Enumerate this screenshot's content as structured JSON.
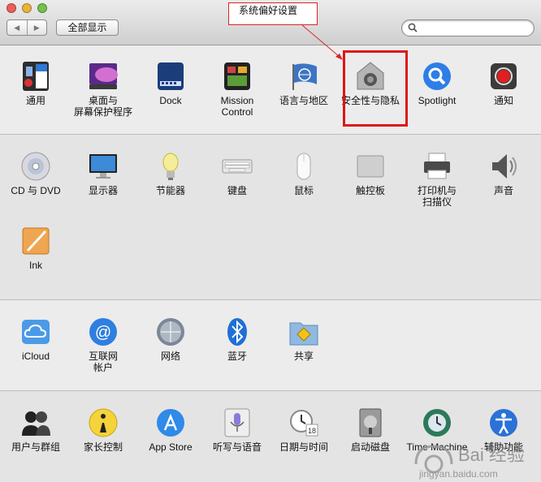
{
  "window": {
    "traffic_lights": [
      "#ec5f56",
      "#e9b43b",
      "#74c14c"
    ]
  },
  "toolbar": {
    "show_all_label": "全部显示",
    "back_icon": "chevron-left-icon",
    "forward_icon": "chevron-right-icon",
    "search_placeholder": ""
  },
  "annotation": {
    "text": "系统偏好设置",
    "highlight_color": "#e01515"
  },
  "rows": [
    [
      {
        "label": "通用",
        "icon": "general-icon"
      },
      {
        "label": "桌面与\n屏幕保护程序",
        "icon": "desktop-icon"
      },
      {
        "label": "Dock",
        "icon": "dock-icon"
      },
      {
        "label": "Mission\nControl",
        "icon": "mission-control-icon"
      },
      {
        "label": "语言与地区",
        "icon": "language-region-icon"
      },
      {
        "label": "安全性与隐私",
        "icon": "security-icon"
      },
      {
        "label": "Spotlight",
        "icon": "spotlight-icon"
      },
      {
        "label": "通知",
        "icon": "notifications-icon"
      }
    ],
    [
      {
        "label": "CD 与 DVD",
        "icon": "cd-dvd-icon"
      },
      {
        "label": "显示器",
        "icon": "display-icon"
      },
      {
        "label": "节能器",
        "icon": "energy-saver-icon"
      },
      {
        "label": "键盘",
        "icon": "keyboard-icon"
      },
      {
        "label": "鼠标",
        "icon": "mouse-icon"
      },
      {
        "label": "触控板",
        "icon": "trackpad-icon"
      },
      {
        "label": "打印机与\n扫描仪",
        "icon": "printer-icon"
      },
      {
        "label": "声音",
        "icon": "sound-icon"
      }
    ],
    [
      {
        "label": "Ink",
        "icon": "ink-icon"
      }
    ],
    [
      {
        "label": "iCloud",
        "icon": "icloud-icon"
      },
      {
        "label": "互联网\n帐户",
        "icon": "internet-accounts-icon"
      },
      {
        "label": "网络",
        "icon": "network-icon"
      },
      {
        "label": "蓝牙",
        "icon": "bluetooth-icon"
      },
      {
        "label": "共享",
        "icon": "sharing-icon"
      }
    ],
    [
      {
        "label": "用户与群组",
        "icon": "users-groups-icon"
      },
      {
        "label": "家长控制",
        "icon": "parental-controls-icon"
      },
      {
        "label": "App Store",
        "icon": "app-store-icon"
      },
      {
        "label": "听写与语音",
        "icon": "dictation-icon"
      },
      {
        "label": "日期与时间",
        "icon": "date-time-icon"
      },
      {
        "label": "启动磁盘",
        "icon": "startup-disk-icon"
      },
      {
        "label": "Time Machine",
        "icon": "time-machine-icon"
      },
      {
        "label": "辅助功能",
        "icon": "accessibility-icon"
      }
    ]
  ],
  "watermark": {
    "text": "Bai 经验",
    "subtext": "jingyan.baidu.com"
  }
}
